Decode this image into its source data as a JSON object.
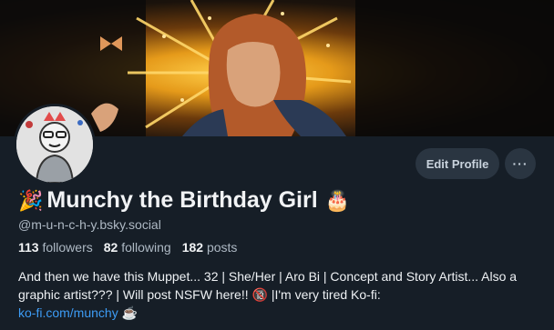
{
  "profile": {
    "display_name": "Munchy the Birthday Girl",
    "name_prefix_emoji": "🎉",
    "name_suffix_emoji": "🎂",
    "handle": "@m-u-n-c-h-y.bsky.social",
    "followers_count": "113",
    "followers_label": "followers",
    "following_count": "82",
    "following_label": "following",
    "posts_count": "182",
    "posts_label": "posts",
    "bio_text": "And then we have this Muppet... 32 | She/Her | Aro Bi | Concept and Story Artist... Also a graphic artist??? | Will post NSFW here!! 🔞 |I'm very tired Ko-fi:",
    "bio_link": "ko-fi.com/munchy",
    "bio_end_emoji": "☕"
  },
  "actions": {
    "edit_profile_label": "Edit Profile",
    "more_label": "···"
  },
  "colors": {
    "background": "#161e27",
    "button": "#2a3541",
    "link": "#3d9cf5",
    "muted_text": "#aeb9c4"
  },
  "icons": [
    "avatar-image",
    "banner-image",
    "more-options-icon"
  ]
}
